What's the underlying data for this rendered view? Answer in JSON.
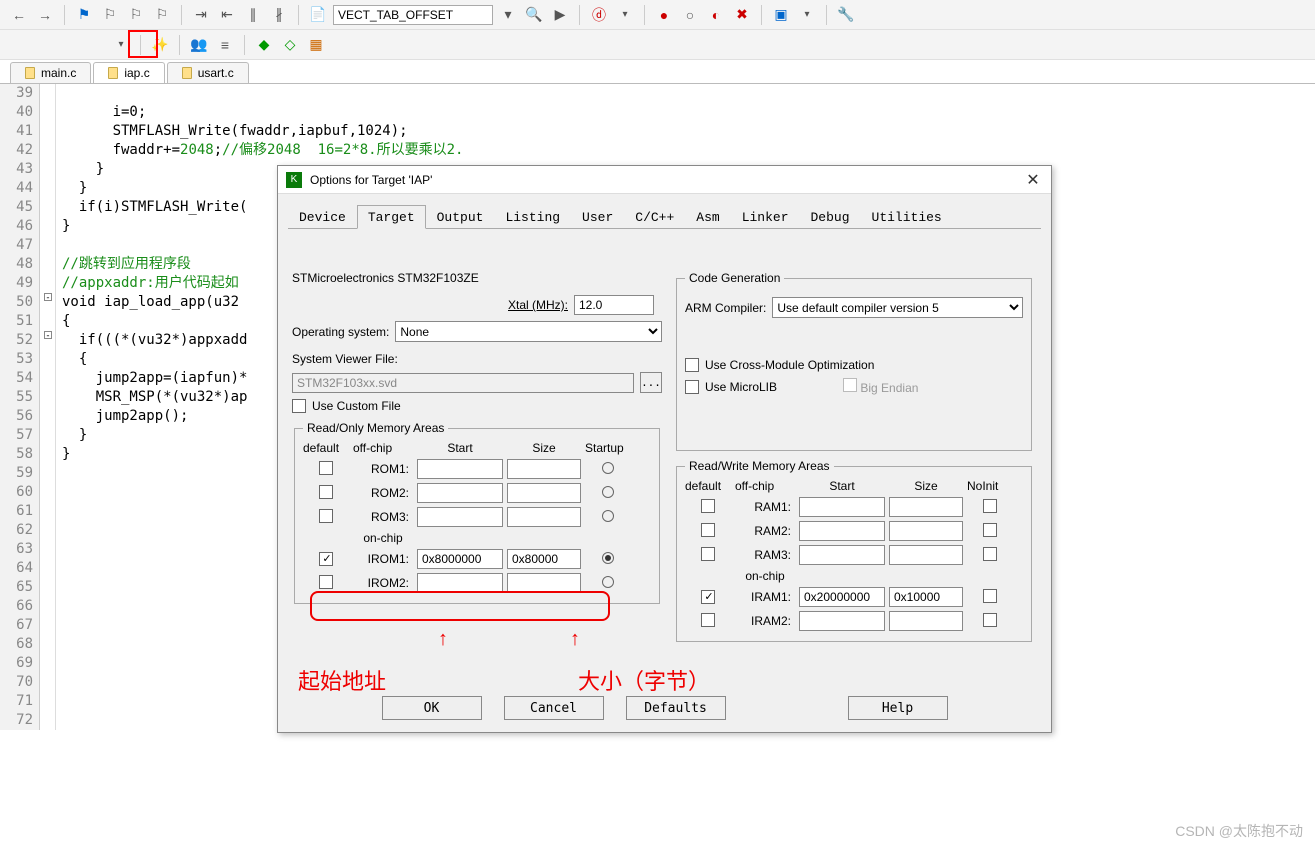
{
  "toolbar_search": "VECT_TAB_OFFSET",
  "file_tabs": {
    "t0": "main.c",
    "t1": "iap.c",
    "t2": "usart.c"
  },
  "code_lines": {
    "l39": "      i=0;",
    "l40": "      STMFLASH_Write(fwaddr,iapbuf,1024);",
    "l41": "      fwaddr+=2048;//偏移2048  16=2*8.所以要乘以2.",
    "l42": "    }",
    "l43": "  }",
    "l44": "  if(i)STMFLASH_Write(",
    "l45": "}",
    "l46": "",
    "l47": "//跳转到应用程序段",
    "l48": "//appxaddr:用户代码起如",
    "l49": "void iap_load_app(u32 ",
    "l50": "{",
    "l51": "  if(((*(vu32*)appxadd",
    "l52": "  {",
    "l53": "    jump2app=(iapfun)*",
    "l54": "    MSR_MSP(*(vu32*)ap",
    "l55": "    jump2app();",
    "l56": "  }",
    "l57": "}"
  },
  "dialog": {
    "title": "Options for Target 'IAP'",
    "tabs": {
      "t0": "Device",
      "t1": "Target",
      "t2": "Output",
      "t3": "Listing",
      "t4": "User",
      "t5": "C/C++",
      "t6": "Asm",
      "t7": "Linker",
      "t8": "Debug",
      "t9": "Utilities"
    },
    "mcu": "STMicroelectronics STM32F103ZE",
    "xtal_label": "Xtal (MHz):",
    "xtal_val": "12.0",
    "os_label": "Operating system:",
    "os_val": "None",
    "svf_label": "System Viewer File:",
    "svf_val": "STM32F103xx.svd",
    "svf_btn": "...",
    "use_custom": "Use Custom File",
    "codegen_title": "Code Generation",
    "arm_comp": "ARM Compiler:",
    "arm_val": "Use default compiler version 5",
    "crossmod": "Use Cross-Module Optimization",
    "microlib": "Use MicroLIB",
    "bigend": "Big Endian",
    "ro_title": "Read/Only Memory Areas",
    "rw_title": "Read/Write Memory Areas",
    "hdr_default": "default",
    "hdr_offchip": "off-chip",
    "hdr_start": "Start",
    "hdr_size": "Size",
    "hdr_startup": "Startup",
    "hdr_noinit": "NoInit",
    "hdr_onchip": "on-chip",
    "rom1": "ROM1:",
    "rom2": "ROM2:",
    "rom3": "ROM3:",
    "irom1": "IROM1:",
    "irom2": "IROM2:",
    "ram1": "RAM1:",
    "ram2": "RAM2:",
    "ram3": "RAM3:",
    "iram1": "IRAM1:",
    "iram2": "IRAM2:",
    "irom1_start": "0x8000000",
    "irom1_size": "0x80000",
    "iram1_start": "0x20000000",
    "iram1_size": "0x10000",
    "btn_ok": "OK",
    "btn_cancel": "Cancel",
    "btn_defaults": "Defaults",
    "btn_help": "Help"
  },
  "annot": {
    "start": "起始地址",
    "size": "大小（字节）"
  },
  "watermark": "CSDN @太陈抱不动"
}
